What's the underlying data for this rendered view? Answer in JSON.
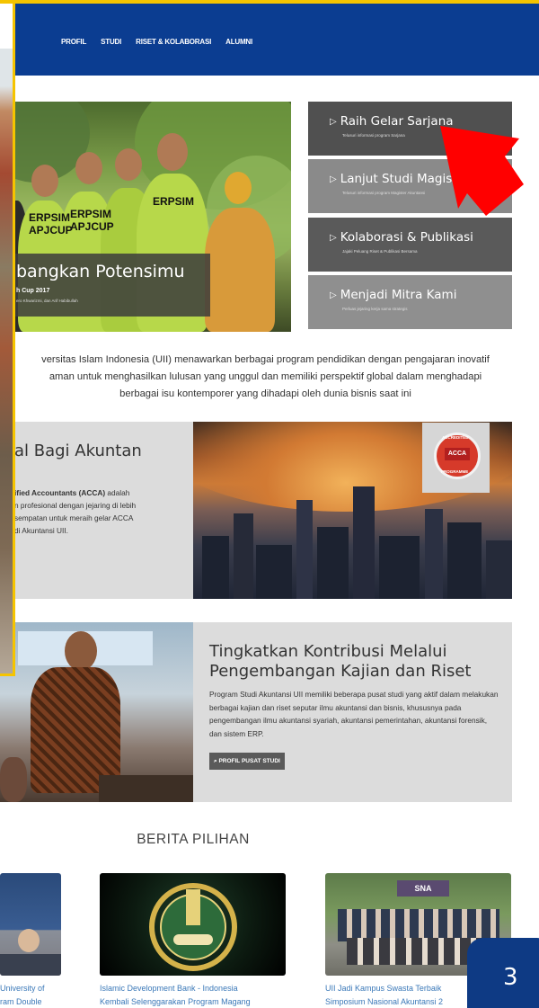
{
  "nav": {
    "items": [
      "PROFIL",
      "STUDI",
      "RISET & KOLABORASI",
      "ALUMNI"
    ]
  },
  "hero": {
    "title": "bangkan Potensimu",
    "subtitle": "h Cup 2017",
    "credits": "ero Khwarizmi, dan Arif Habibullah",
    "shirt_text": [
      "ERPSIM",
      "APJCUP",
      "ERPSIM",
      "APJCUP",
      "ERPSIM"
    ]
  },
  "menu": [
    {
      "label": "Raih Gelar Sarjana",
      "sub": "Telusuri informasi program Sarjana",
      "color": "#505050"
    },
    {
      "label": "Lanjut Studi Magister",
      "sub": "Telusuri informasi program Magister Akuntansi",
      "color": "#8a8a8a"
    },
    {
      "label": "Kolaborasi & Publikasi",
      "sub": "Jajaki Peluang Riset & Publikasi Bersama",
      "color": "#5a5a5a"
    },
    {
      "label": "Menjadi Mitra Kami",
      "sub": "Perluas jejaring kerja sama strategis",
      "color": "#8f8f8f"
    }
  ],
  "intro": {
    "line1": "versitas Islam Indonesia (UII) menawarkan berbagai program pendidikan dengan pengajaran inovatif",
    "line2": "aman untuk menghasilkan lulusan yang unggul dan memiliki perspektif global dalam menghadapi",
    "line3": "berbagai isu kontemporer yang dihadapi oleh dunia bisnis saat ini"
  },
  "acca": {
    "title": "al Bagi Akuntan",
    "body_bold": "ified Accountants (ACCA)",
    "body_rest1": " adalah",
    "body_line2": "n profesional dengan jejaring di lebih",
    "body_line3": "sempatan untuk meraih gelar ACCA",
    "body_line4": "di Akuntansi UII.",
    "logo_mid": "ACCA",
    "logo_top": "ACCREDITED",
    "logo_bottom": "PROGRAMME"
  },
  "riset": {
    "title_line1": "Tingkatkan Kontribusi Melalui",
    "title_line2": "Pengembangan Kajian dan Riset",
    "body": "Program Studi Akuntansi UII memiliki beberapa pusat studi yang aktif dalam melakukan berbagai kajian dan riset seputar ilmu akuntansi dan bisnis, khususnya pada pengembangan ilmu akuntansi syariah, akuntansi pemerintahan, akuntansi forensik, dan sistem ERP.",
    "button": "⌕ PROFIL PUSAT STUDI"
  },
  "berita": {
    "heading": "BERITA PILIHAN",
    "items": [
      {
        "line1": "University of",
        "line2": "ram Double"
      },
      {
        "line1": "Islamic Development Bank - Indonesia",
        "line2": "Kembali Selenggarakan Program Magang"
      },
      {
        "line1": "UII Jadi Kampus Swasta Terbaik",
        "line2": "Simposium Nasional Akuntansi 2"
      }
    ],
    "sna_label": "SNA"
  },
  "badge": {
    "number": "3",
    "color": "#0e3a84"
  },
  "colors": {
    "nav": "#0b3d91",
    "accent": "#f5c400",
    "arrow": "#ff0000"
  }
}
